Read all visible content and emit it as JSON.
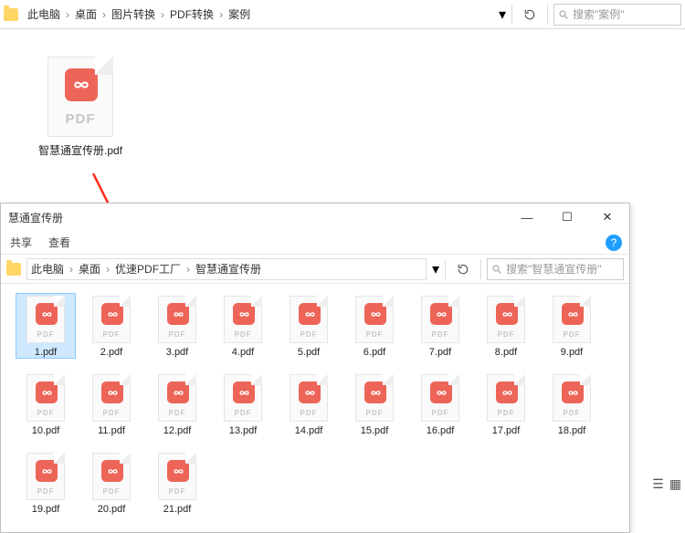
{
  "top": {
    "breadcrumb": [
      "此电脑",
      "桌面",
      "图片转换",
      "PDF转换",
      "案例"
    ],
    "search_placeholder": "搜索\"案例\"",
    "file": {
      "name": "智慧通宣传册.pdf",
      "type_label": "PDF"
    }
  },
  "win2": {
    "title": "慧通宣传册",
    "menu": {
      "share": "共享",
      "view": "查看"
    },
    "breadcrumb": [
      "此电脑",
      "桌面",
      "优速PDF工厂",
      "智慧通宣传册"
    ],
    "search_placeholder": "搜索\"智慧通宣传册\"",
    "files": [
      {
        "name": "1.pdf",
        "selected": true
      },
      {
        "name": "2.pdf",
        "selected": false
      },
      {
        "name": "3.pdf",
        "selected": false
      },
      {
        "name": "4.pdf",
        "selected": false
      },
      {
        "name": "5.pdf",
        "selected": false
      },
      {
        "name": "6.pdf",
        "selected": false
      },
      {
        "name": "7.pdf",
        "selected": false
      },
      {
        "name": "8.pdf",
        "selected": false
      },
      {
        "name": "9.pdf",
        "selected": false
      },
      {
        "name": "10.pdf",
        "selected": false
      },
      {
        "name": "11.pdf",
        "selected": false
      },
      {
        "name": "12.pdf",
        "selected": false
      },
      {
        "name": "13.pdf",
        "selected": false
      },
      {
        "name": "14.pdf",
        "selected": false
      },
      {
        "name": "15.pdf",
        "selected": false
      },
      {
        "name": "16.pdf",
        "selected": false
      },
      {
        "name": "17.pdf",
        "selected": false
      },
      {
        "name": "18.pdf",
        "selected": false
      },
      {
        "name": "19.pdf",
        "selected": false
      },
      {
        "name": "20.pdf",
        "selected": false
      },
      {
        "name": "21.pdf",
        "selected": false
      }
    ],
    "type_label": "PDF",
    "window_controls": {
      "minimize": "—",
      "maximize": "☐",
      "close": "✕"
    }
  }
}
